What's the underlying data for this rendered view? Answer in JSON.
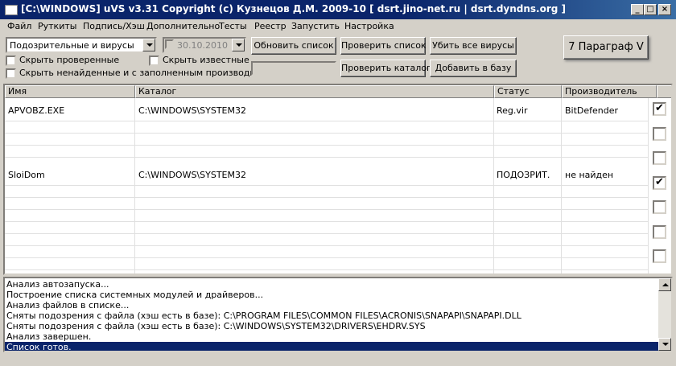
{
  "window": {
    "title": "[C:\\WINDOWS] uVS v3.31 Copyright (c) Кузнецов Д.М. 2009-10 [ dsrt.jino-net.ru | dsrt.dyndns.org ]",
    "minimize_glyph": "_",
    "maximize_glyph": "□",
    "close_glyph": "×"
  },
  "menu": [
    "Файл",
    "Руткиты",
    "Подпись/Хэш",
    "Дополнительно",
    "Тесты",
    "Реестр",
    "Запустить",
    "Настройка"
  ],
  "toolbar": {
    "filter_select": "Подозрительные и вирусы",
    "date_select": "30.10.2010",
    "buttons": {
      "refresh": "Обновить список",
      "check_list": "Проверить список",
      "kill_viruses": "Убить все вирусы",
      "check_dir": "Проверить каталог",
      "add_to_db": "Добавить в базу",
      "paragraph": "7 Параграф V"
    },
    "checkboxes": {
      "hide_checked": "Скрыть проверенные",
      "hide_known": "Скрыть известные",
      "hide_not_found": "Скрыть ненайденные и с заполненным производителем"
    }
  },
  "table": {
    "columns": [
      "Имя",
      "Каталог",
      "Статус",
      "Производитель"
    ],
    "rows": [
      {
        "name": "APVOBZ.EXE",
        "dir": "C:\\WINDOWS\\SYSTEM32",
        "status": "Reg.vir",
        "vendor": "BitDefender"
      },
      {
        "name": "SloiDom",
        "dir": "C:\\WINDOWS\\SYSTEM32",
        "status": "ПОДОЗРИТ.",
        "vendor": "не найден"
      }
    ],
    "checkboxes": [
      true,
      false,
      false,
      true,
      false,
      false,
      false
    ]
  },
  "log": {
    "lines": [
      "Анализ автозапуска...",
      "Построение списка системных модулей и драйверов...",
      "Анализ файлов в списке...",
      "Сняты подозрения с файла (хэш есть в базе): C:\\PROGRAM FILES\\COMMON FILES\\ACRONIS\\SNAPAPI\\SNAPAPI.DLL",
      "Сняты подозрения с файла (хэш есть в базе): C:\\WINDOWS\\SYSTEM32\\DRIVERS\\EHDRV.SYS",
      "Анализ завершен.",
      "Список готов."
    ]
  }
}
